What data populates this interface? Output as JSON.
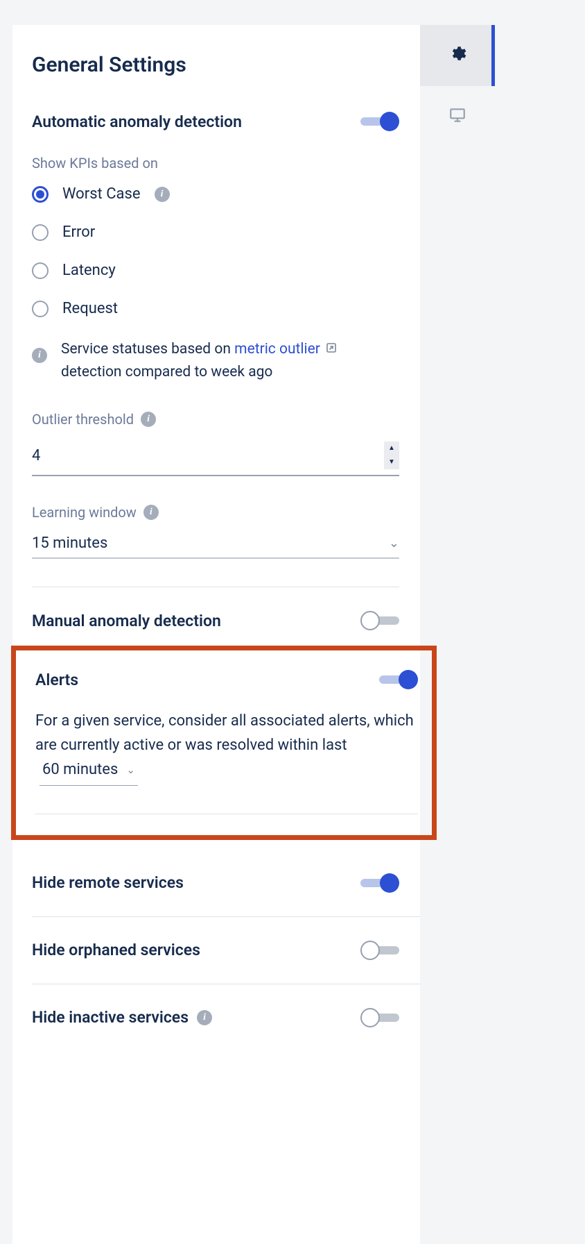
{
  "page_title": "General Settings",
  "auto_anomaly": {
    "title": "Automatic anomaly detection",
    "enabled": true,
    "kpi_label": "Show KPIs based on",
    "options": [
      "Worst Case",
      "Error",
      "Latency",
      "Request"
    ],
    "selected": "Worst Case",
    "status_note_prefix": "Service statuses based on ",
    "status_note_link": "metric outlier",
    "status_note_suffix": " detection compared to week ago",
    "outlier_label": "Outlier threshold",
    "outlier_value": "4",
    "learning_label": "Learning window",
    "learning_value": "15 minutes"
  },
  "manual_anomaly": {
    "title": "Manual anomaly detection",
    "enabled": false
  },
  "alerts": {
    "title": "Alerts",
    "enabled": true,
    "desc_prefix": "For a given service, consider all associated alerts, which are currently active or was resolved within last",
    "window": "60 minutes"
  },
  "hide_remote": {
    "title": "Hide remote services",
    "enabled": true
  },
  "hide_orphaned": {
    "title": "Hide orphaned services",
    "enabled": false
  },
  "hide_inactive": {
    "title": "Hide inactive services",
    "enabled": false
  }
}
